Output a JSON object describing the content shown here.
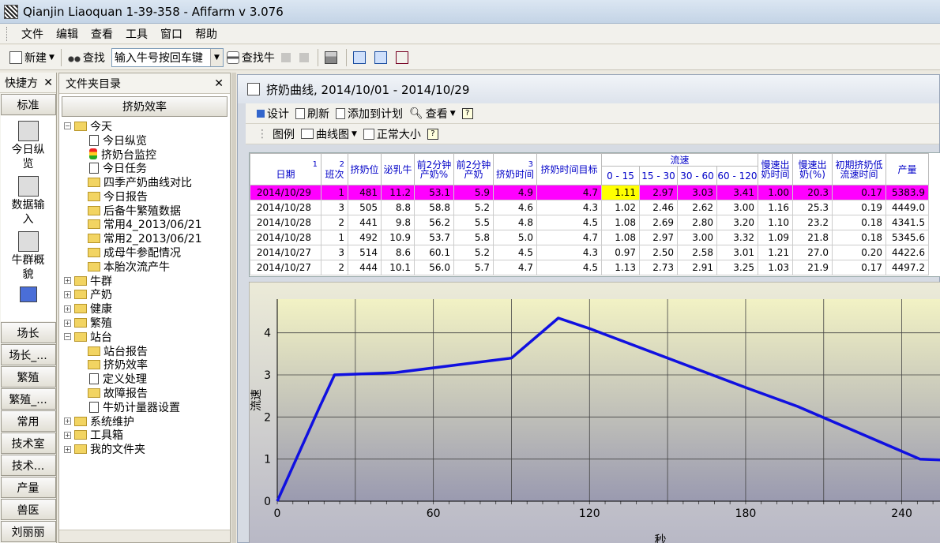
{
  "window": {
    "title": "Qianjin Liaoquan 1-39-358 - Afifarm v 3.076"
  },
  "menu": [
    "文件",
    "编辑",
    "查看",
    "工具",
    "窗口",
    "帮助"
  ],
  "toolbar": {
    "new_label": "新建",
    "find_label": "查找",
    "cow_input_value": "输入牛号按回车键",
    "find_cow_label": "查找牛"
  },
  "quick_panel": {
    "title": "快捷方",
    "standard_button": "标准",
    "items": [
      "今日纵览",
      "数据输入",
      "牛群概貌"
    ],
    "groups": [
      "场长",
      "场长_...",
      "繁殖",
      "繁殖_...",
      "常用",
      "技术室",
      "技术...",
      "产量",
      "兽医",
      "刘丽丽"
    ]
  },
  "folders": {
    "title": "文件夹目录",
    "current_button": "挤奶效率",
    "tree": [
      {
        "label": "今天",
        "kind": "folder-open",
        "level": 0
      },
      {
        "label": "今日纵览",
        "kind": "page",
        "level": 1
      },
      {
        "label": "挤奶台监控",
        "kind": "light",
        "level": 1
      },
      {
        "label": "今日任务",
        "kind": "page",
        "level": 1
      },
      {
        "label": "四季产奶曲线对比",
        "kind": "folder",
        "level": 1
      },
      {
        "label": "今日报告",
        "kind": "folder",
        "level": 1
      },
      {
        "label": "后备牛繁殖数据",
        "kind": "folder",
        "level": 1
      },
      {
        "label": "常用4_2013/06/21",
        "kind": "folder",
        "level": 1
      },
      {
        "label": "常用2_2013/06/21",
        "kind": "folder",
        "level": 1
      },
      {
        "label": "成母牛参配情况",
        "kind": "folder",
        "level": 1
      },
      {
        "label": "本胎次流产牛",
        "kind": "folder",
        "level": 1
      },
      {
        "label": "牛群",
        "kind": "folder",
        "level": 0
      },
      {
        "label": "产奶",
        "kind": "folder",
        "level": 0
      },
      {
        "label": "健康",
        "kind": "folder",
        "level": 0
      },
      {
        "label": "繁殖",
        "kind": "folder",
        "level": 0
      },
      {
        "label": "站台",
        "kind": "folder-open",
        "level": 0
      },
      {
        "label": "站台报告",
        "kind": "folder",
        "level": 1
      },
      {
        "label": "挤奶效率",
        "kind": "folder",
        "level": 1
      },
      {
        "label": "定义处理",
        "kind": "page",
        "level": 1
      },
      {
        "label": "故障报告",
        "kind": "folder",
        "level": 1
      },
      {
        "label": "牛奶计量器设置",
        "kind": "page",
        "level": 1
      },
      {
        "label": "系统维护",
        "kind": "folder",
        "level": 0
      },
      {
        "label": "工具箱",
        "kind": "folder",
        "level": 0
      },
      {
        "label": "我的文件夹",
        "kind": "folder",
        "level": 0
      }
    ]
  },
  "main": {
    "title": "挤奶曲线, 2014/10/01 - 2014/10/29",
    "toolbar1": {
      "design": "设计",
      "refresh": "刷新",
      "add_plan": "添加到计划",
      "view": "查看"
    },
    "toolbar2": {
      "legend": "图例",
      "curve": "曲线图",
      "normal_size": "正常大小"
    },
    "table": {
      "headers": {
        "date": "日期",
        "shift": "班次",
        "stall": "挤奶位",
        "lactating": "泌乳牛",
        "first2min_pct": "前2分钟产奶%",
        "first2min_milk": "前2分钟产奶",
        "milk_time": "挤奶时间",
        "milk_time_target": "挤奶时间目标",
        "flow": "流速",
        "flow_bins": [
          "0 - 15",
          "15 - 30",
          "30 - 60",
          "60 - 120"
        ],
        "slow_out": "慢速出奶时间",
        "slow_pct": "慢速出奶(%)",
        "init_low_flow": "初期挤奶低流速时间",
        "yield": "产量",
        "sort_marks": [
          "1",
          "2",
          "3"
        ]
      },
      "rows": [
        [
          "2014/10/29",
          "1",
          "481",
          "11.2",
          "53.1",
          "5.9",
          "4.9",
          "4.7",
          "1.11",
          "2.97",
          "3.03",
          "3.41",
          "1.00",
          "20.3",
          "0.17",
          "5383.9"
        ],
        [
          "2014/10/28",
          "3",
          "505",
          "8.8",
          "58.8",
          "5.2",
          "4.6",
          "4.3",
          "1.02",
          "2.46",
          "2.62",
          "3.00",
          "1.16",
          "25.3",
          "0.19",
          "4449.0"
        ],
        [
          "2014/10/28",
          "2",
          "441",
          "9.8",
          "56.2",
          "5.5",
          "4.8",
          "4.5",
          "1.08",
          "2.69",
          "2.80",
          "3.20",
          "1.10",
          "23.2",
          "0.18",
          "4341.5"
        ],
        [
          "2014/10/28",
          "1",
          "492",
          "10.9",
          "53.7",
          "5.8",
          "5.0",
          "4.7",
          "1.08",
          "2.97",
          "3.00",
          "3.32",
          "1.09",
          "21.8",
          "0.18",
          "5345.6"
        ],
        [
          "2014/10/27",
          "3",
          "514",
          "8.6",
          "60.1",
          "5.2",
          "4.5",
          "4.3",
          "0.97",
          "2.50",
          "2.58",
          "3.01",
          "1.21",
          "27.0",
          "0.20",
          "4422.6"
        ],
        [
          "2014/10/27",
          "2",
          "444",
          "10.1",
          "56.0",
          "5.7",
          "4.7",
          "4.5",
          "1.13",
          "2.73",
          "2.91",
          "3.25",
          "1.03",
          "21.9",
          "0.17",
          "4497.2"
        ]
      ],
      "selected_row": 0
    }
  },
  "chart_data": {
    "type": "line",
    "xlabel": "秒",
    "ylabel": "流速",
    "xlim": [
      0,
      255
    ],
    "ylim": [
      0,
      4.8
    ],
    "xticks": [
      0,
      60,
      120,
      180,
      240
    ],
    "yticks": [
      0,
      1,
      2,
      3,
      4
    ],
    "grid": true,
    "series": [
      {
        "color": "#1010e0",
        "x": [
          0,
          8,
          16,
          22,
          45,
          90,
          108,
          120,
          180,
          200,
          247,
          255
        ],
        "y": [
          0,
          1.1,
          2.2,
          3.0,
          3.05,
          3.4,
          4.35,
          4.1,
          2.7,
          2.25,
          1.0,
          0.98
        ]
      }
    ]
  }
}
